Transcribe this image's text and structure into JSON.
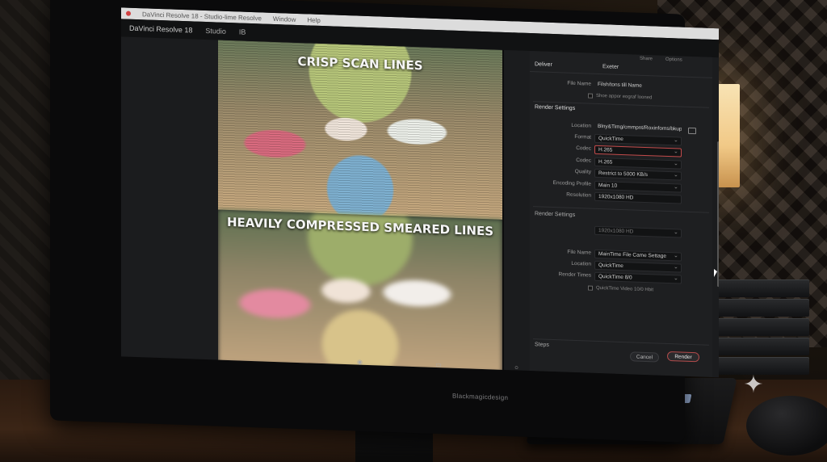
{
  "window": {
    "title": "DaVinci Resolve 18 - Studio-lime Resolve",
    "menu": [
      "Window",
      "Help"
    ]
  },
  "app_bar": {
    "app_name": "DaVinci Resolve 18",
    "tabs": [
      "Studio",
      "IB"
    ]
  },
  "viewer": {
    "caption_top": "CRISP SCAN LINES",
    "caption_bottom": "HEAVILY COMPRESSED SMEARED LINES"
  },
  "deliver_panel": {
    "title": "Deliver",
    "subtitle": "Exeter",
    "top_icons": [
      "Share",
      "Options"
    ],
    "file_name_label": "File Name",
    "file_name_value": "Filsh/tons till Name",
    "checkbox_label": "Shoe appor eograf looned",
    "render_settings_title": "Render Settings",
    "rows": [
      {
        "label": "Location",
        "value": "Blny&Timg/cmmpnt/Roxinfoms/bkups"
      },
      {
        "label": "Format",
        "value": "QuickTime"
      },
      {
        "label": "Codec",
        "value": "H.265"
      },
      {
        "label": "Codec",
        "value": "H.265"
      },
      {
        "label": "Quality",
        "value": "Restrict to 5000 KB/s"
      },
      {
        "label": "Encoding Profile",
        "value": "Main 10"
      },
      {
        "label": "Resolution",
        "value": "1920x1080 HD"
      }
    ],
    "second_section_title": "Render Settings",
    "second_dropdown_value": "1920x1080 HD",
    "second_rows": [
      {
        "label": "File Name",
        "value": "MainTime File Came Settage"
      },
      {
        "label": "Location",
        "value": "QuickTime"
      },
      {
        "label": "Render Times",
        "value": "QuickTime 8/0"
      }
    ],
    "second_check": "QuickTime Video 10/0 Hbit",
    "footer_label": "Steps",
    "cancel_label": "Cancel",
    "render_label": "Render"
  },
  "monitor": {
    "brand": "Blackmagicdesign"
  },
  "colors": {
    "accent_red": "#c34b4b",
    "panel_bg": "#1e1f21",
    "lamp": "#f1c987"
  },
  "icons": [
    "folder-icon",
    "cursor-icon",
    "sparkle-icon"
  ]
}
